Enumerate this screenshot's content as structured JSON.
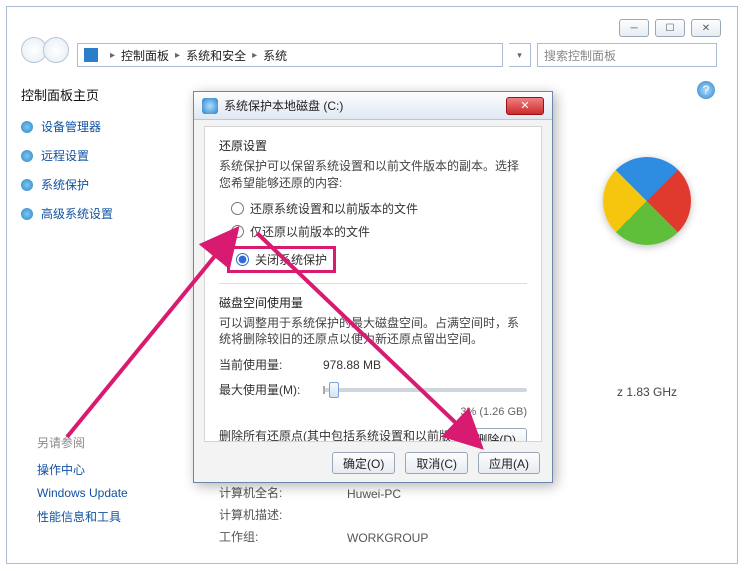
{
  "breadcrumb": {
    "root": "控制面板",
    "l2": "系统和安全",
    "l3": "系统"
  },
  "search": {
    "placeholder": "搜索控制面板"
  },
  "sidebar": {
    "title": "控制面板主页",
    "items": [
      {
        "label": "设备管理器"
      },
      {
        "label": "远程设置"
      },
      {
        "label": "系统保护"
      },
      {
        "label": "高级系统设置"
      }
    ]
  },
  "seealso": {
    "title": "另请参阅",
    "links": [
      {
        "label": "操作中心"
      },
      {
        "label": "Windows Update"
      },
      {
        "label": "性能信息和工具"
      }
    ]
  },
  "dlg": {
    "title": "系统保护本地磁盘 (C:)",
    "restore_title": "还原设置",
    "restore_desc": "系统保护可以保留系统设置和以前文件版本的副本。选择您希望能够还原的内容:",
    "opt1": "还原系统设置和以前版本的文件",
    "opt2": "仅还原以前版本的文件",
    "opt3": "关闭系统保护",
    "disk_title": "磁盘空间使用量",
    "disk_desc": "可以调整用于系统保护的最大磁盘空间。占满空间时，系统将删除较旧的还原点以便为新还原点留出空间。",
    "current_label": "当前使用量:",
    "current_value": "978.88 MB",
    "max_label": "最大使用量(M):",
    "pct": "3% (1.26 GB)",
    "del_desc": "删除所有还原点(其中包括系统设置和以前版本的文件)。",
    "del_btn": "删除(D)",
    "ok": "确定(O)",
    "cancel": "取消(C)",
    "apply": "应用(A)"
  },
  "sysinfo": {
    "ghz": "z  1.83 GHz",
    "name_label": "计算机全名:",
    "name_value": "Huwei-PC",
    "desc_label": "计算机描述:",
    "wg_label": "工作组:",
    "wg_value": "WORKGROUP"
  }
}
